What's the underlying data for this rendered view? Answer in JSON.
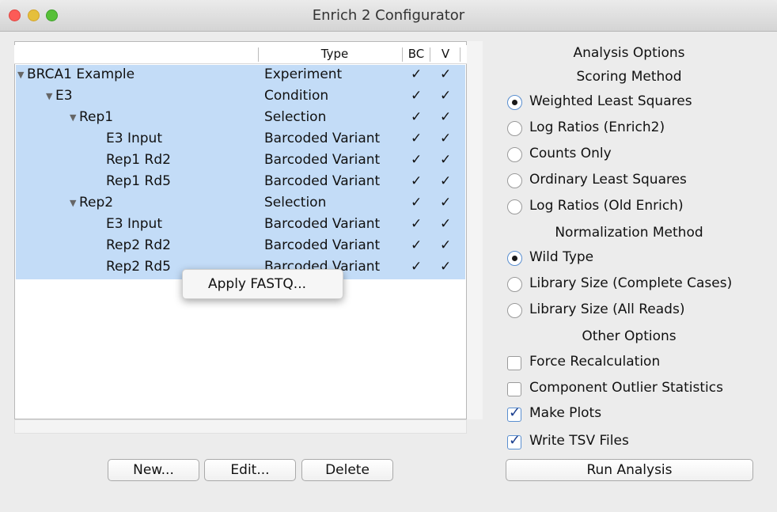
{
  "window": {
    "title": "Enrich 2 Configurator"
  },
  "tree": {
    "columns": {
      "name": "",
      "type": "Type",
      "bc": "BC",
      "v": "V"
    },
    "rows": [
      {
        "name": "BRCA1 Example",
        "expander": "▼",
        "type": "Experiment",
        "bc": "✓",
        "v": "✓"
      },
      {
        "name": "E3",
        "expander": "▼",
        "type": "Condition",
        "bc": "✓",
        "v": "✓"
      },
      {
        "name": "Rep1",
        "expander": "▼",
        "type": "Selection",
        "bc": "✓",
        "v": "✓"
      },
      {
        "name": "E3 Input",
        "expander": "",
        "type": "Barcoded Variant",
        "bc": "✓",
        "v": "✓"
      },
      {
        "name": "Rep1 Rd2",
        "expander": "",
        "type": "Barcoded Variant",
        "bc": "✓",
        "v": "✓"
      },
      {
        "name": "Rep1 Rd5",
        "expander": "",
        "type": "Barcoded Variant",
        "bc": "✓",
        "v": "✓"
      },
      {
        "name": "Rep2",
        "expander": "▼",
        "type": "Selection",
        "bc": "✓",
        "v": "✓"
      },
      {
        "name": "E3 Input",
        "expander": "",
        "type": "Barcoded Variant",
        "bc": "✓",
        "v": "✓"
      },
      {
        "name": "Rep2 Rd2",
        "expander": "",
        "type": "Barcoded Variant",
        "bc": "✓",
        "v": "✓"
      },
      {
        "name": "Rep2 Rd5",
        "expander": "",
        "type": "Barcoded Variant",
        "bc": "✓",
        "v": "✓"
      }
    ]
  },
  "context_menu": {
    "items": [
      "Apply FASTQ..."
    ]
  },
  "buttons": {
    "new": "New...",
    "edit": "Edit...",
    "delete": "Delete",
    "run": "Run Analysis"
  },
  "options": {
    "analysis_title": "Analysis Options",
    "scoring_title": "Scoring Method",
    "scoring": [
      {
        "label": "Weighted Least Squares",
        "selected": true
      },
      {
        "label": "Log Ratios (Enrich2)",
        "selected": false
      },
      {
        "label": "Counts Only",
        "selected": false
      },
      {
        "label": "Ordinary Least Squares",
        "selected": false
      },
      {
        "label": "Log Ratios (Old Enrich)",
        "selected": false
      }
    ],
    "normalization_title": "Normalization Method",
    "normalization": [
      {
        "label": "Wild Type",
        "selected": true
      },
      {
        "label": "Library Size (Complete Cases)",
        "selected": false
      },
      {
        "label": "Library Size (All Reads)",
        "selected": false
      }
    ],
    "other_title": "Other Options",
    "other": [
      {
        "label": "Force Recalculation",
        "checked": false
      },
      {
        "label": "Component Outlier Statistics",
        "checked": false
      },
      {
        "label": "Make Plots",
        "checked": true
      },
      {
        "label": "Write TSV Files",
        "checked": true
      }
    ]
  },
  "colors": {
    "selection": "#c3dcf7",
    "accent": "#1b3f8f"
  }
}
